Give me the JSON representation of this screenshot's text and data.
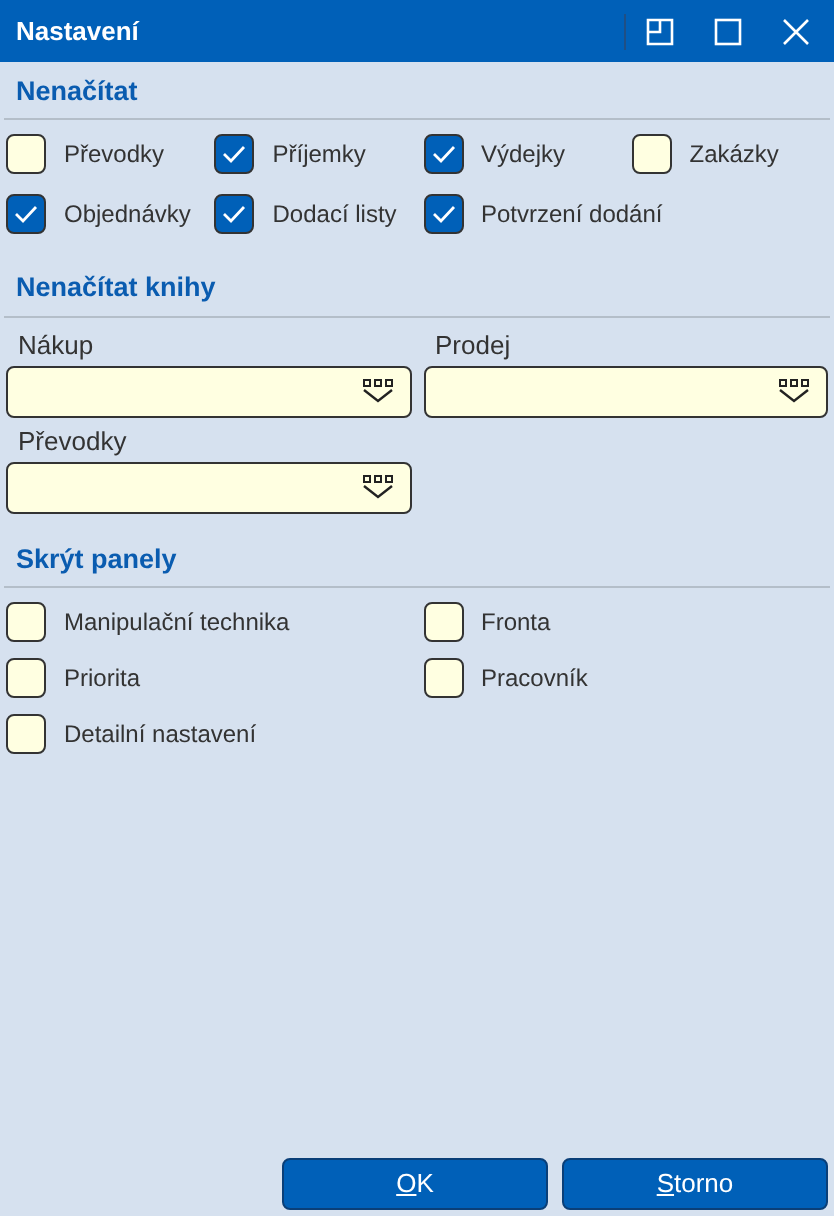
{
  "window": {
    "title": "Nastavení"
  },
  "sections": [
    {
      "kind": "checkgrid",
      "title": "Nenačítat",
      "items": [
        {
          "label": "Převodky",
          "checked": false
        },
        {
          "label": "Příjemky",
          "checked": true
        },
        {
          "label": "Výdejky",
          "checked": true
        },
        {
          "label": "Zakázky",
          "checked": false
        },
        {
          "label": "Objednávky",
          "checked": true
        },
        {
          "label": "Dodací listy",
          "checked": true
        },
        {
          "label": "Potvrzení dodání",
          "checked": true
        }
      ]
    },
    {
      "kind": "fields",
      "title": "Nenačítat knihy",
      "items": [
        {
          "label": "Nákup"
        },
        {
          "label": "Prodej"
        },
        {
          "label": "Převodky"
        }
      ]
    },
    {
      "kind": "checklist",
      "title": "Skrýt panely",
      "items": [
        {
          "label": "Manipulační technika",
          "checked": false
        },
        {
          "label": "Fronta",
          "checked": false
        },
        {
          "label": "Priorita",
          "checked": false
        },
        {
          "label": "Pracovník",
          "checked": false
        },
        {
          "label": "Detailní nastavení",
          "checked": false
        }
      ]
    }
  ],
  "buttons": [
    {
      "hotkey": "O",
      "rest": "K"
    },
    {
      "hotkey": "S",
      "rest": "torno"
    }
  ]
}
